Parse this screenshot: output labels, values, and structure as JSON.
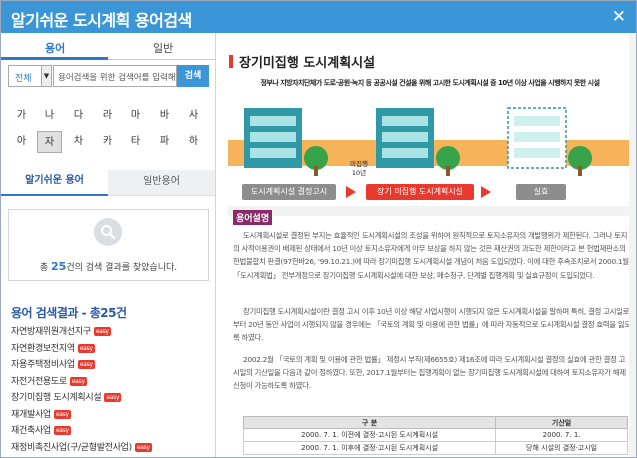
{
  "window": {
    "title": "알기쉬운 도시계획 용어검색",
    "close_label": "✕"
  },
  "left": {
    "mode_tabs": {
      "active": "용어",
      "inactive": "일반"
    },
    "search": {
      "select_value": "전체",
      "placeholder": "용어검색을 위한 검색어를 입력해주세요",
      "button": "검색"
    },
    "consonants": [
      "가",
      "나",
      "다",
      "라",
      "마",
      "바",
      "사",
      "아",
      "자",
      "차",
      "카",
      "타",
      "파",
      "하"
    ],
    "selected_consonant": "자",
    "list_tabs": {
      "active": "알기쉬운 용어",
      "inactive": "일반용어"
    },
    "result_box": {
      "prefix": "총 ",
      "count": "25",
      "suffix": "건의 검색 결과를 찾았습니다."
    },
    "results_title": "용어 검색결과 - 총25건",
    "results": [
      "자연방재위원개선지구",
      "자연환경보전지역",
      "자용주택정비사업",
      "자전거전용도로",
      "장기미집행 도시계획시설",
      "재개발사업",
      "재건축사업",
      "재정비촉진사업(구/균형발전사업)"
    ],
    "badge_text": "easy"
  },
  "right": {
    "title": "장기미집행 도시계획시설",
    "illustration": {
      "caption": "정부나 지방자치단체가 도로·공원·녹지 등 공공시설 건설을 위해 고시한 도시계획시설 중 10년 이상 사업을 시행하지 못한 시설",
      "step1": "도시계획시설 결정고시",
      "step2_label_a": "미집행",
      "step2_label_b": "10년",
      "step2": "장기 미집행 도시계획시설",
      "step3": "실효"
    },
    "section_label": "용어설명",
    "paragraphs": [
      "도시계획시설로 결정된 부지는 효율적인 도시계획시설의 조성을 위하여 원칙적으로 토지소유자의 개발행위가 제한된다. 그러나 토지의 사적이용권이 배제된 상태에서 10년 이상 토지소유자에게 아무 보상을 하지 않는 것은 재산권의 과도한 제한이라고 본 헌법재판소의 헌법불합치 판결(97헌바26, '99.10.21.)에 따라 장기미집행 도시계획시설 개념이 처음 도입되었다. 이에 대한 후속조치로서 2000.1월 「도시계획법」 전부개정으로 장기미집행 도시계획시설에 대한 보상, 매수청구, 단계별 집행계획 및 실효규정이 도입되었다.",
      "장기미집행 도시계획시설이란 결정 고시 이후 10년 이상 해당 사업시행이 시행되지 않은 도시계획시설을 말하며 특히, 결정 고시일로부터 20년 동안 사업이 시행되지 않을 경우에는 「국토의 계획 및 이용에 관한 법률」에 따라 자동적으로 도시계획시설 결정 효력을 잃도록 하였다.",
      "2002.2월 「국토의 계획 및 이용에 관한 법률」 제정시 부칙(제6655호) 제16조에 따라 도시계획시설 결정의 실효에 관한 결정 고시일의 기산일을 다음과 같이 정하였다. 또한, 2017.1월부터는 집행계획이 없는 장기미집행 도시계획시설에 대하여 토지소유자가 해제 신청이 가능하도록 하였다."
    ],
    "table": {
      "headers": [
        "구 분",
        "기산일"
      ],
      "rows": [
        [
          "2000. 7. 1. 이전에 결정·고시된 도시계획시설",
          "2000. 7. 1."
        ],
        [
          "2000. 7. 1. 이후에 결정·고시된 도시계획시설",
          "당해 시설의 결정·고시일"
        ]
      ]
    }
  },
  "colors": {
    "primary": "#3a96d6",
    "accent": "#e8392e",
    "section": "#8a2a68"
  }
}
